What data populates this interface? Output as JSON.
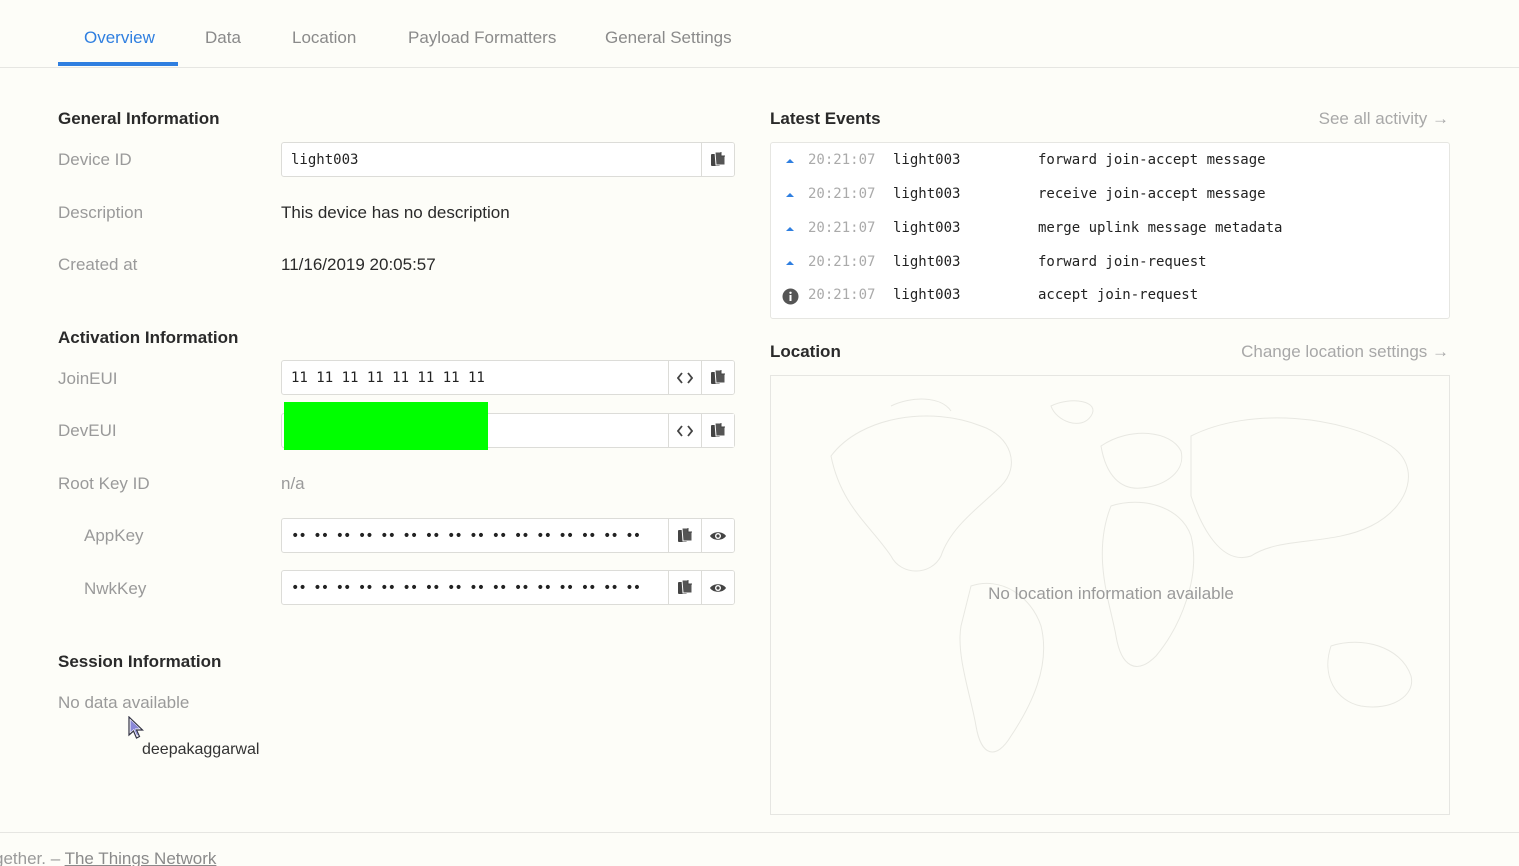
{
  "tabs": [
    {
      "label": "Overview",
      "active": true
    },
    {
      "label": "Data",
      "active": false
    },
    {
      "label": "Location",
      "active": false
    },
    {
      "label": "Payload Formatters",
      "active": false
    },
    {
      "label": "General Settings",
      "active": false
    }
  ],
  "general": {
    "title": "General Information",
    "device_id_label": "Device ID",
    "device_id_value": "light003",
    "description_label": "Description",
    "description_value": "This device has no description",
    "created_label": "Created at",
    "created_value": "11/16/2019 20:05:57"
  },
  "activation": {
    "title": "Activation Information",
    "joineui_label": "JoinEUI",
    "joineui_value": "11 11 11 11 11 11 11 11",
    "deveui_label": "DevEUI",
    "deveui_value": "",
    "rootkey_label": "Root Key ID",
    "rootkey_value": "n/a",
    "appkey_label": "AppKey",
    "appkey_value": "•• •• •• •• •• •• •• •• •• •• •• •• •• •• •• ••",
    "nwkkey_label": "NwkKey",
    "nwkkey_value": "•• •• •• •• •• •• •• •• •• •• •• •• •• •• •• ••"
  },
  "session": {
    "title": "Session Information",
    "empty": "No data available"
  },
  "events": {
    "title": "Latest Events",
    "see_all": "See all activity →",
    "rows": [
      {
        "icon": "uplink-arrow-icon",
        "time": "20:21:07",
        "device": "light003",
        "message": "forward join-accept message"
      },
      {
        "icon": "uplink-arrow-icon",
        "time": "20:21:07",
        "device": "light003",
        "message": "receive join-accept message"
      },
      {
        "icon": "uplink-arrow-icon",
        "time": "20:21:07",
        "device": "light003",
        "message": "merge uplink message metadata"
      },
      {
        "icon": "uplink-arrow-icon",
        "time": "20:21:07",
        "device": "light003",
        "message": "forward join-request"
      },
      {
        "icon": "info-icon",
        "time": "20:21:07",
        "device": "light003",
        "message": "accept join-request"
      }
    ]
  },
  "location": {
    "title": "Location",
    "change_link": "Change location settings →",
    "empty": "No location information available"
  },
  "footer": {
    "text": "gether. – ",
    "link": "The Things Network"
  },
  "overlay": {
    "user": "deepakaggarwal"
  },
  "colors": {
    "accent": "#2f7fe0",
    "redaction": "#00ff00"
  }
}
